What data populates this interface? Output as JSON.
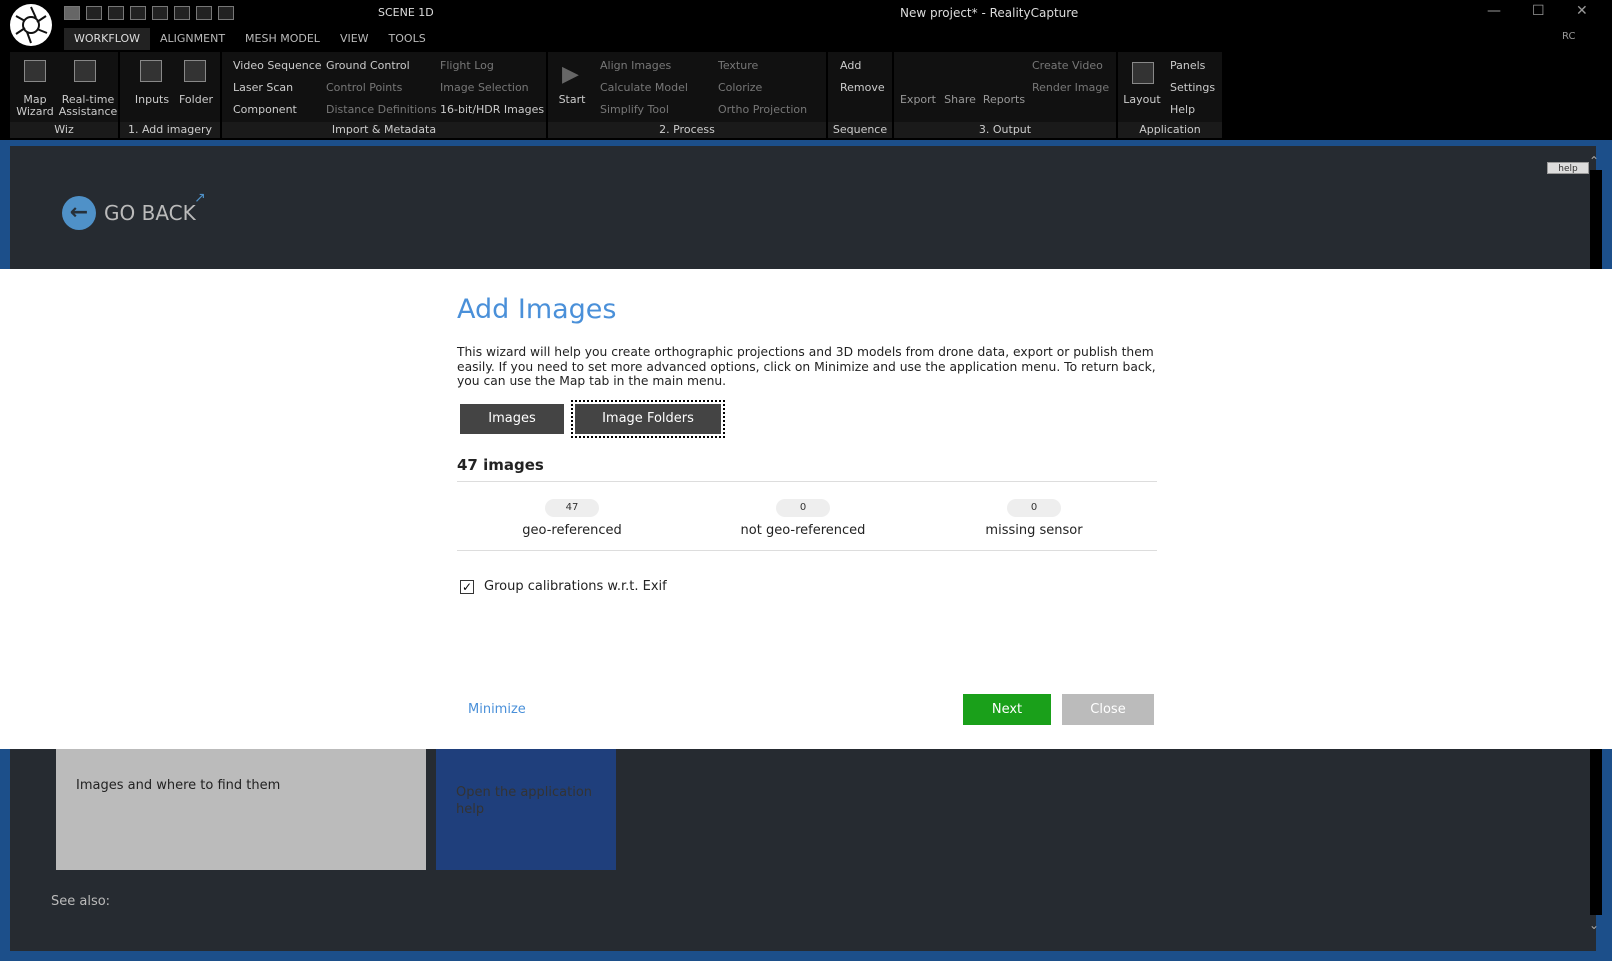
{
  "titlebar": {
    "scene": "SCENE 1D",
    "title": "New project* - RealityCapture",
    "rc": "RC"
  },
  "tabs": [
    "WORKFLOW",
    "ALIGNMENT",
    "MESH MODEL",
    "VIEW",
    "TOOLS"
  ],
  "ribbon": {
    "wiz": {
      "map": "Map Wizard",
      "rt": "Real-time Assistance",
      "footer": "Wiz"
    },
    "add": {
      "inputs": "Inputs",
      "folder": "Folder",
      "footer": "1. Add imagery"
    },
    "import": {
      "col1": [
        "Video Sequence",
        "Laser Scan",
        "Component"
      ],
      "col2": [
        "Ground Control",
        "Control Points",
        "Distance Definitions"
      ],
      "col3": [
        "Flight Log",
        "Image Selection",
        "16-bit/HDR Images"
      ],
      "footer": "Import & Metadata"
    },
    "process": {
      "start": "Start",
      "col1": [
        "Align Images",
        "Calculate Model",
        "Simplify Tool"
      ],
      "col2": [
        "Texture",
        "Colorize",
        "Ortho Projection"
      ],
      "footer": "2. Process"
    },
    "sequence": {
      "items": [
        "Add",
        "Remove"
      ],
      "footer": "Sequence"
    },
    "output": {
      "export": "Export",
      "share": "Share",
      "reports": "Reports",
      "col": [
        "Create Video",
        "Render Image"
      ],
      "footer": "3. Output"
    },
    "application": {
      "layout": "Layout",
      "col": [
        "Panels",
        "Settings",
        "Help"
      ],
      "footer": "Application"
    }
  },
  "help_page": {
    "help_btn": "help",
    "go_back": "GO BACK",
    "card1": "Images and where to find them",
    "card2": "Open the application help",
    "see_also": "See also:"
  },
  "modal": {
    "title": "Add Images",
    "description": "This wizard will help you create orthographic projections and 3D models from drone data, export or publish them easily. If you need to set more advanced options, click on Minimize and use the application menu. To return back, you can use the Map tab in the main menu.",
    "btn_images": "Images",
    "btn_folders": "Image Folders",
    "count": "47 images",
    "stats": [
      {
        "value": "47",
        "label": "geo-referenced"
      },
      {
        "value": "0",
        "label": "not geo-referenced"
      },
      {
        "value": "0",
        "label": "missing sensor"
      }
    ],
    "checkbox_label": "Group calibrations w.r.t. Exif",
    "checkbox_checked": true,
    "minimize": "Minimize",
    "next": "Next",
    "close": "Close"
  },
  "colors": {
    "accent": "#4a90d9",
    "next": "#1aa01a",
    "frame": "#1c4f8a"
  }
}
